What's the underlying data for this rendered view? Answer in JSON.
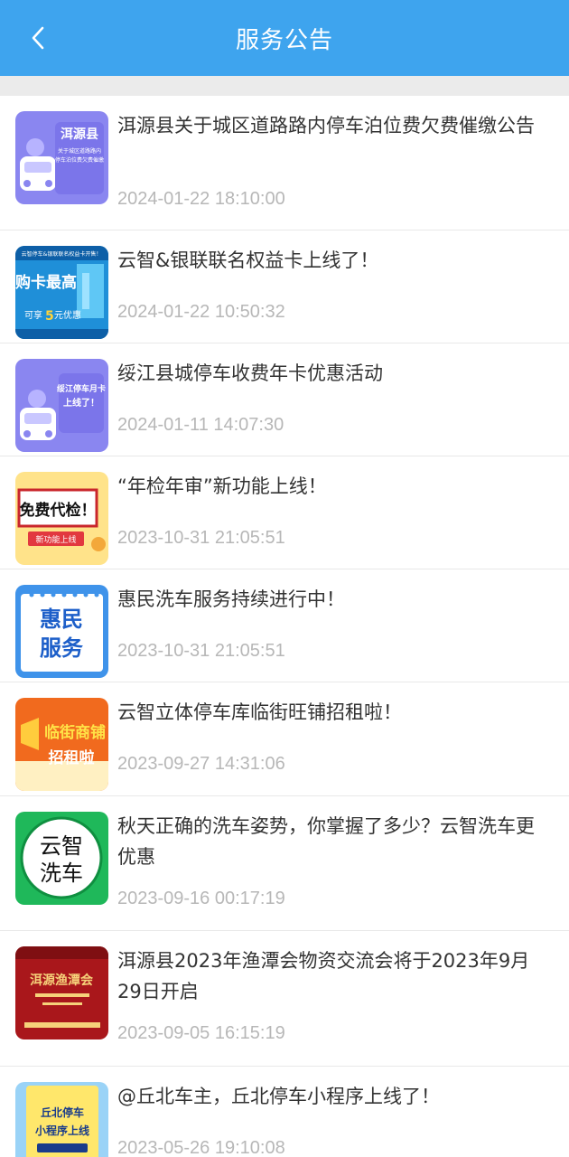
{
  "header": {
    "title": "服务公告"
  },
  "items": [
    {
      "title": "洱源县关于城区道路路内停车泊位费欠费催缴公告",
      "date": "2024-01-22 18:10:00",
      "thumb": {
        "theme": "purple-car",
        "line1": "洱源县",
        "line2": "关于城区道路路内",
        "line3": "停车泊位费欠费催缴",
        "line4": ""
      }
    },
    {
      "title": "云智&银联联名权益卡上线了！",
      "date": "2024-01-22 10:50:32",
      "thumb": {
        "theme": "blue-card",
        "line1": "云智停车&银联联名权益卡开售！",
        "line2": "购卡最高",
        "line3": "可享",
        "line4": "5",
        "line5": "元优惠"
      }
    },
    {
      "title": "绥江县城停车收费年卡优惠活动",
      "date": "2024-01-11 14:07:30",
      "thumb": {
        "theme": "purple-car",
        "line1": "绥江停车月卡",
        "line2": "上线了！",
        "line3": "",
        "line4": ""
      }
    },
    {
      "title": "“年检年审”新功能上线！",
      "date": "2023-10-31 21:05:51",
      "thumb": {
        "theme": "yellow",
        "line1": "免费代检！",
        "line2": "新功能上线"
      }
    },
    {
      "title": "惠民洗车服务持续进行中！",
      "date": "2023-10-31 21:05:51",
      "thumb": {
        "theme": "calendar",
        "line1": "惠民",
        "line2": "服务"
      }
    },
    {
      "title": "云智立体停车库临街旺铺招租啦！",
      "date": "2023-09-27 14:31:06",
      "thumb": {
        "theme": "orange",
        "line1": "临街商铺",
        "line2": "招租啦"
      }
    },
    {
      "title": "秋天正确的洗车姿势，你掌握了多少？云智洗车更优惠",
      "date": "2023-09-16 00:17:19",
      "thumb": {
        "theme": "green",
        "line1": "云智",
        "line2": "洗车"
      }
    },
    {
      "title": "洱源县2023年渔潭会物资交流会将于2023年9月29日开启",
      "date": "2023-09-05 16:15:19",
      "thumb": {
        "theme": "red",
        "line1": "洱源渔潭会"
      }
    },
    {
      "title": "@丘北车主，丘北停车小程序上线了！",
      "date": "2023-05-26 19:10:08",
      "thumb": {
        "theme": "yellow-board",
        "line1": "丘北停车",
        "line2": "小程序上线"
      }
    }
  ]
}
